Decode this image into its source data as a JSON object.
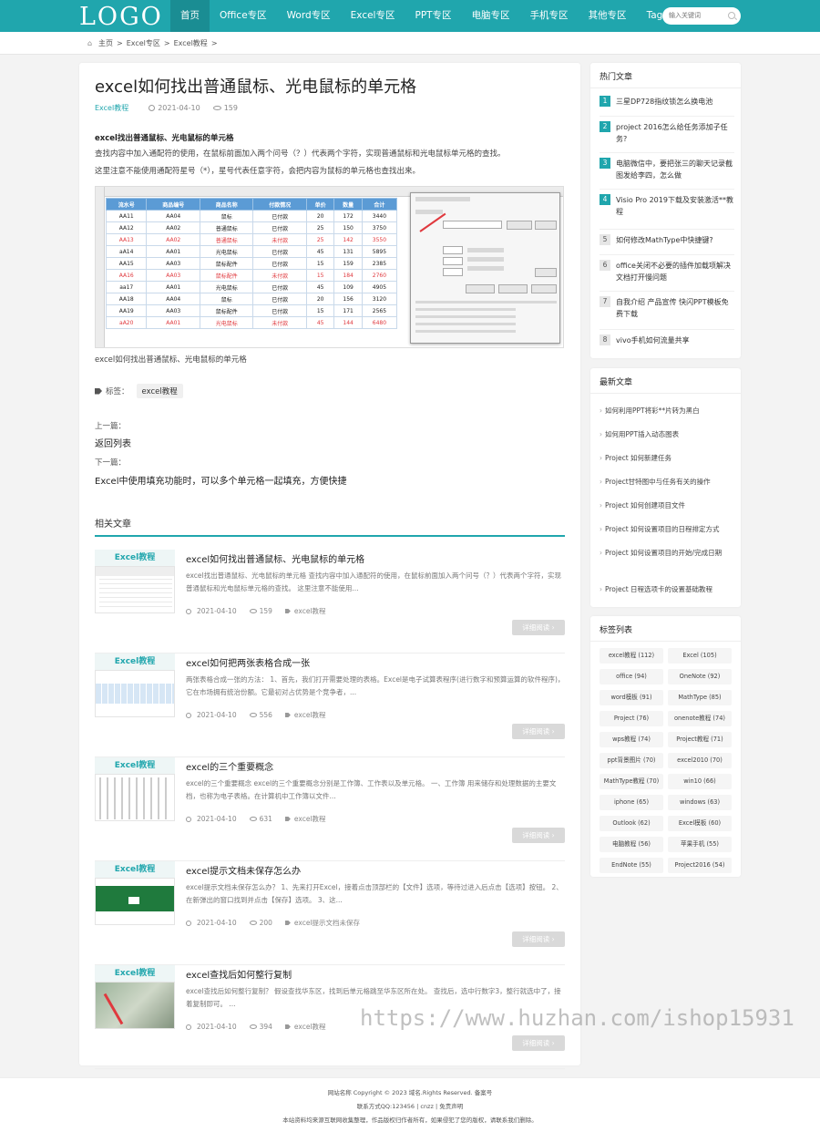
{
  "header": {
    "logo": "LOGO",
    "nav": [
      "首页",
      "Office专区",
      "Word专区",
      "Excel专区",
      "PPT专区",
      "电脑专区",
      "手机专区",
      "其他专区",
      "Tag标签"
    ],
    "search_placeholder": "输入关键词"
  },
  "breadcrumb": {
    "home": "主页",
    "section": "Excel专区",
    "category": "Excel教程",
    "sep": ">"
  },
  "article": {
    "title": "excel如何找出普通鼠标、光电鼠标的单元格",
    "category": "Excel教程",
    "date": "2021-04-10",
    "views": "159",
    "subheading": "excel找出普通鼠标、光电鼠标的单元格",
    "para1": "查找内容中加入通配符的使用，在鼠标前面加入两个问号（？）代表两个字符，实现普通鼠标和光电鼠标单元格的查找。",
    "para2": "这里注意不能使用通配符星号（*），星号代表任意字符，会把内容为鼠标的单元格也查找出来。",
    "caption": "excel如何找出普通鼠标、光电鼠标的单元格",
    "tags_label": "标签：",
    "tag": "excel教程",
    "prev_label": "上一篇：",
    "prev_link": "返回列表",
    "next_label": "下一篇：",
    "next_link": "Excel中使用填充功能时，可以多个单元格一起填充，方便快捷"
  },
  "sheet": {
    "col_letters": [
      "A",
      "B",
      "C",
      "D",
      "E",
      "F",
      "G",
      "H",
      "I",
      "J",
      "K"
    ],
    "headers": [
      "流水号",
      "商品编号",
      "商品名称",
      "付款情况",
      "单价",
      "数量",
      "合计"
    ],
    "rows": [
      {
        "c": [
          "AA11",
          "AA04",
          "鼠标",
          "已付款",
          "20",
          "172",
          "3440"
        ],
        "red": false
      },
      {
        "c": [
          "AA12",
          "AA02",
          "普通鼠标",
          "已付款",
          "25",
          "150",
          "3750"
        ],
        "red": false
      },
      {
        "c": [
          "AA13",
          "AA02",
          "普通鼠标",
          "未付款",
          "25",
          "142",
          "3550"
        ],
        "red": true
      },
      {
        "c": [
          "aA14",
          "AA01",
          "光电鼠标",
          "已付款",
          "45",
          "131",
          "5895"
        ],
        "red": false
      },
      {
        "c": [
          "AA15",
          "AA03",
          "鼠标配件",
          "已付款",
          "15",
          "159",
          "2385"
        ],
        "red": false
      },
      {
        "c": [
          "AA16",
          "AA03",
          "鼠标配件",
          "未付款",
          "15",
          "184",
          "2760"
        ],
        "red": true
      },
      {
        "c": [
          "aa17",
          "AA01",
          "光电鼠标",
          "已付款",
          "45",
          "109",
          "4905"
        ],
        "red": false
      },
      {
        "c": [
          "AA18",
          "AA04",
          "鼠标",
          "已付款",
          "20",
          "156",
          "3120"
        ],
        "red": false
      },
      {
        "c": [
          "AA19",
          "AA03",
          "鼠标配件",
          "已付款",
          "15",
          "171",
          "2565"
        ],
        "red": false
      },
      {
        "c": [
          "aA20",
          "AA01",
          "光电鼠标",
          "未付款",
          "45",
          "144",
          "6480"
        ],
        "red": true
      }
    ]
  },
  "related": {
    "title": "相关文章",
    "more_label": "详细阅读 ›",
    "items": [
      {
        "badge": "Excel教程",
        "title": "excel如何找出普通鼠标、光电鼠标的单元格",
        "excerpt": "excel找出普通鼠标、光电鼠标的单元格 查找内容中加入通配符的使用，在鼠标前面加入两个问号（？）代表两个字符，实现普通鼠标和光电鼠标单元格的查找。 这里注意不能使用...",
        "date": "2021-04-10",
        "views": "159",
        "tag": "excel教程",
        "thumb": "sheet"
      },
      {
        "badge": "Excel教程",
        "title": "excel如何把两张表格合成一张",
        "excerpt": "两张表格合成一张的方法： 1、首先，我们打开需要处理的表格。Excel是电子试算表程序(进行数字和预算运算的软件程序)，它在市场拥有统治份额。它最初对占优势是个竞争者，...",
        "date": "2021-04-10",
        "views": "556",
        "tag": "excel教程",
        "thumb": "wide"
      },
      {
        "badge": "Excel教程",
        "title": "excel的三个重要概念",
        "excerpt": "excel的三个重要概念 excel的三个重要概念分别是工作簿、工作表以及单元格。 一、工作簿 用来储存和处理数据的主要文档，也称为电子表格。在计算机中工作簿以文件...",
        "date": "2021-04-10",
        "views": "631",
        "tag": "excel教程",
        "thumb": "grid"
      },
      {
        "badge": "Excel教程",
        "title": "excel提示文档未保存怎么办",
        "excerpt": "excel提示文档未保存怎么办？ 1、先来打开Excel，接着点击顶部栏的【文件】选项，等待过进入后点击【选项】按钮。 2、在新弹出的窗口找到并点击【保存】选项。 3、这...",
        "date": "2021-04-10",
        "views": "200",
        "tag": "excel提示文档未保存",
        "thumb": "green"
      },
      {
        "badge": "Excel教程",
        "title": "excel查找后如何整行复制",
        "excerpt": "excel查找后如何整行复制？ 假设查找华东区，找到后单元格跳至华东区所在处。 查找后，选中行数字3，整行就选中了，接着复制即可。 ...",
        "date": "2021-04-10",
        "views": "394",
        "tag": "excel教程",
        "thumb": "photo"
      }
    ]
  },
  "hot": {
    "title": "热门文章",
    "items": [
      {
        "n": "1",
        "t": "三星DP728指纹锁怎么换电池"
      },
      {
        "n": "2",
        "t": "project 2016怎么给任务添加子任务?"
      },
      {
        "n": "3",
        "t": "电脑微信中，要把张三的聊天记录截图发给李四，怎么做"
      },
      {
        "n": "4",
        "t": "Visio Pro 2019下载及安装激活**教程"
      },
      {
        "n": "5",
        "t": "如何修改MathType中快捷键?"
      },
      {
        "n": "6",
        "t": "office关闭不必要的插件加载项解决文档打开慢问题"
      },
      {
        "n": "7",
        "t": "自我介绍 产品宣传 快闪PPT模板免费下载"
      },
      {
        "n": "8",
        "t": "vivo手机如何流量共享"
      }
    ]
  },
  "latest": {
    "title": "最新文章",
    "items": [
      "如何利用PPT将彩**片转为黑白",
      "如何用PPT插入动态图表",
      "Project 如何新建任务",
      "Project甘特图中与任务有关的操作",
      "Project 如何创建项目文件",
      "Project 如何设置项目的日程排定方式",
      "Project 如何设置项目的开始/完成日期",
      "Project 日程选项卡的设置基础教程"
    ]
  },
  "tag_list": {
    "title": "标签列表",
    "items": [
      "excel教程 (112)",
      "Excel (105)",
      "office (94)",
      "OneNote (92)",
      "word模板 (91)",
      "MathType (85)",
      "Project (76)",
      "onenote教程 (74)",
      "wps教程 (74)",
      "Project教程 (71)",
      "ppt背景图片 (70)",
      "excel2010 (70)",
      "MathType教程 (70)",
      "win10 (66)",
      "iphone (65)",
      "windows (63)",
      "Outlook (62)",
      "Excel模板 (60)",
      "电脑教程 (56)",
      "苹果手机 (55)",
      "EndNote (55)",
      "Project2016 (54)"
    ]
  },
  "footer": {
    "line1": "网站名称 Copyright © 2023 域名.Rights Reserved. 备案号",
    "line2": "联系方式QQ:123456 | cnzz | 免责声明",
    "line3": "本站资料均来源互联网收集整理，作品版权归作者所有，如果侵犯了您的版权，请联系我们删除。"
  },
  "watermark": "https://www.huzhan.com/ishop15931"
}
